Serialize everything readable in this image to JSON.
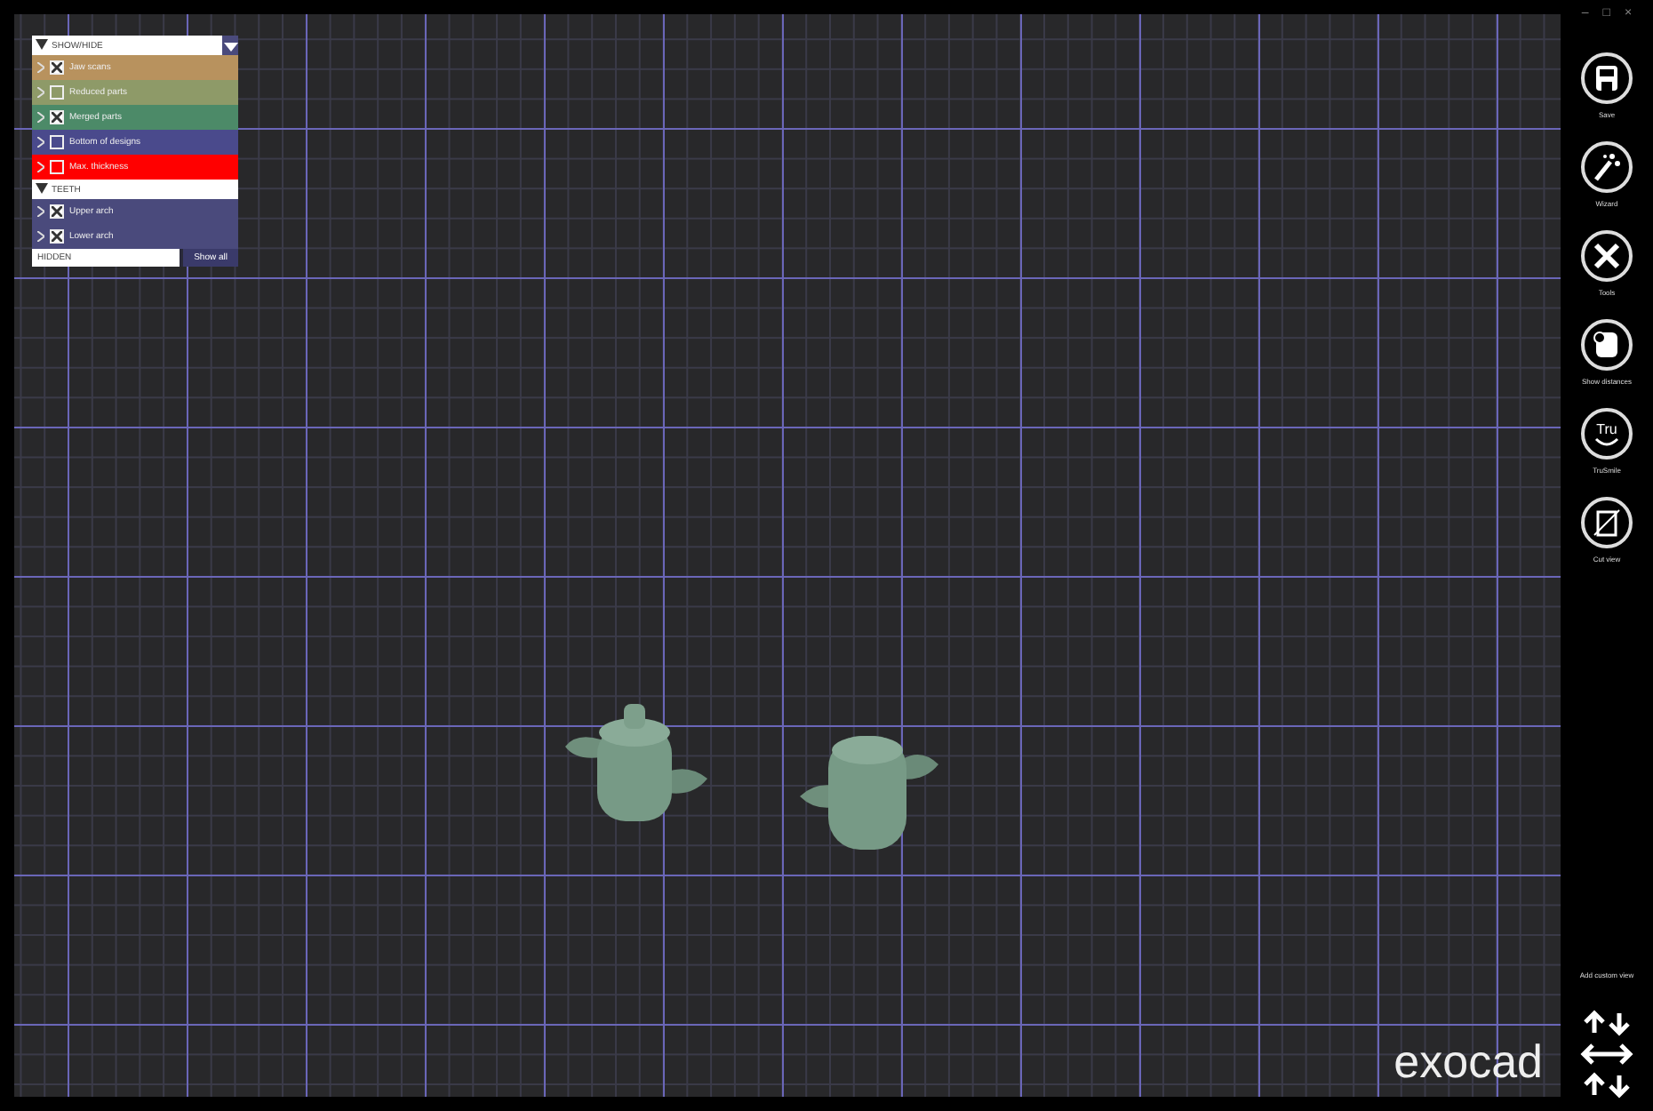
{
  "window_controls": [
    "–",
    "□",
    "×"
  ],
  "panel": {
    "groups": [
      {
        "title": "SHOW/HIDE",
        "expanded": true,
        "items": [
          {
            "label": "Jaw scans",
            "checked": true,
            "color": "#b8925e"
          },
          {
            "label": "Reduced parts",
            "checked": false,
            "color": "#8e9a68"
          },
          {
            "label": "Merged parts",
            "checked": true,
            "color": "#4c8a68"
          },
          {
            "label": "Bottom of designs",
            "checked": false,
            "color": "#4a4a8c"
          },
          {
            "label": "Max. thickness",
            "checked": false,
            "color": "#ff0000"
          }
        ]
      },
      {
        "title": "TEETH",
        "expanded": true,
        "items": [
          {
            "label": "Upper arch",
            "checked": true,
            "color": "#4a4a7c"
          },
          {
            "label": "Lower arch",
            "checked": true,
            "color": "#4a4a7c"
          }
        ]
      }
    ],
    "hidden_label": "HIDDEN",
    "show_all": "Show all"
  },
  "toolbar": [
    {
      "label": "Save",
      "kind": "save"
    },
    {
      "label": "Wizard",
      "kind": "wizard"
    },
    {
      "label": "Tools",
      "kind": "tools"
    },
    {
      "label": "Show distances",
      "kind": "distances"
    },
    {
      "label": "TruSmile",
      "kind": "trusmile",
      "glyph": "Tru"
    },
    {
      "label": "Cut view",
      "kind": "cut"
    }
  ],
  "custom_view": "Add custom view",
  "logo": "exocad"
}
